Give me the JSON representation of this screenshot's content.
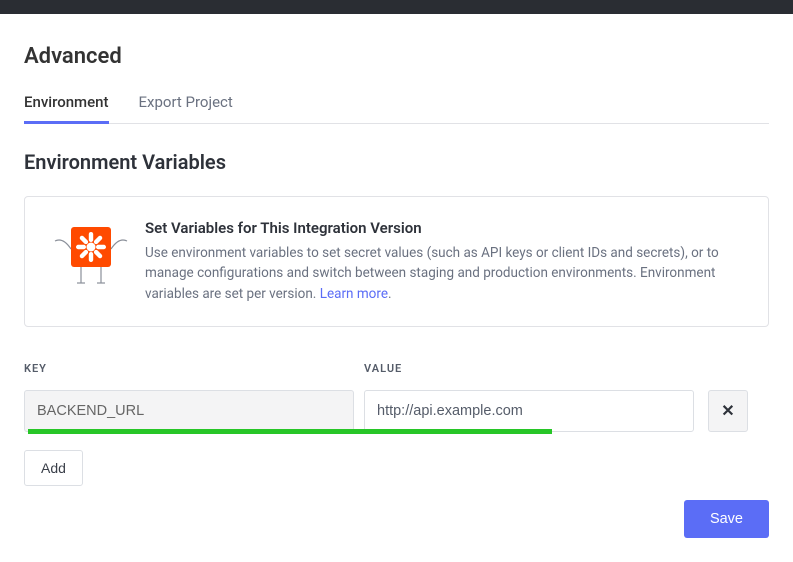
{
  "page_title": "Advanced",
  "tabs": {
    "environment": "Environment",
    "export": "Export Project"
  },
  "section_title": "Environment Variables",
  "info": {
    "heading": "Set Variables for This Integration Version",
    "body_prefix": "Use environment variables to set secret values (such as API keys or client IDs and secrets), or to manage configurations and switch between staging and production environments. Environment variables are set per version. ",
    "learn_more": "Learn more",
    "body_suffix": "."
  },
  "columns": {
    "key": "KEY",
    "value": "VALUE"
  },
  "row": {
    "key": "BACKEND_URL",
    "value": "http://api.example.com"
  },
  "buttons": {
    "remove_symbol": "✕",
    "add": "Add",
    "save": "Save"
  }
}
